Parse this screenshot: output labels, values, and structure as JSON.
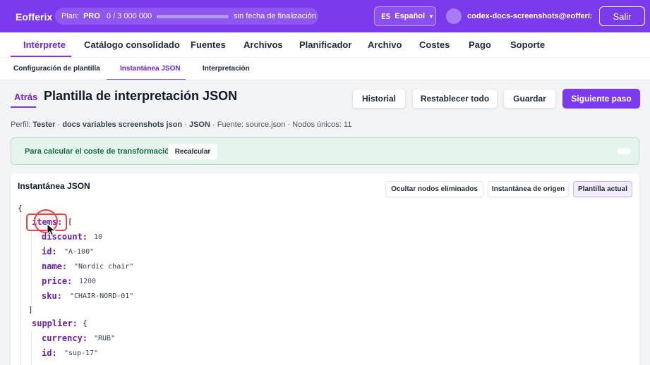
{
  "topbar": {
    "brand": "Eofferix",
    "plan_label": "Plan:",
    "plan_name": "PRO",
    "plan_usage": "0 / 3 000 000",
    "plan_progress": 0.01,
    "plan_expiry": "sin fecha de finalización",
    "lang_code": "ES",
    "lang_name": "Español",
    "user_email": "codex-docs-screenshots@eofferix",
    "logout_label": "Salir"
  },
  "main_nav": [
    "Intérprete",
    "Catálogo consolidado",
    "Fuentes",
    "Archivos",
    "Planificador",
    "Archivo",
    "Costes",
    "Pago",
    "Soporte"
  ],
  "sub_nav": [
    "Configuración de plantilla",
    "Instantánea JSON",
    "Interpretación"
  ],
  "header": {
    "back_label": "Atrás",
    "title": "Plantilla de interpretación JSON",
    "buttons": {
      "history": "Historial",
      "reset": "Restablecer todo",
      "save": "Guardar",
      "next": "Siguiente paso"
    }
  },
  "meta": {
    "profile_label": "Perfil:",
    "profile": "Tester",
    "sep": "·",
    "docs": "docs variables screenshots json",
    "format": "JSON",
    "source": "Fuente: source.json",
    "nodes": "Nodos únicos: 11"
  },
  "notice": {
    "text": "Para calcular el coste de transformación",
    "recalc": "Recalcular"
  },
  "snapshot": {
    "title": "Instantánea JSON",
    "btn_hide": "Ocultar nodos eliminados",
    "btn_source": "Instantánea de origen",
    "btn_current": "Plantilla actual"
  },
  "json": {
    "open_brace": "{",
    "items_key": "items",
    "items_open": "[",
    "items_close": "]",
    "colon": ":",
    "items": [
      {
        "key": "discount",
        "value": "10",
        "kind": "num"
      },
      {
        "key": "id",
        "value": "\"A-100\"",
        "kind": "str"
      },
      {
        "key": "name",
        "value": "\"Nordic chair\"",
        "kind": "str"
      },
      {
        "key": "price",
        "value": "1200",
        "kind": "num"
      },
      {
        "key": "sku",
        "value": "\"CHAIR-NORD-01\"",
        "kind": "str"
      }
    ],
    "supplier_key": "supplier",
    "supplier_open": "{",
    "supplier": [
      {
        "key": "currency",
        "value": "\"RUB\"",
        "kind": "str"
      },
      {
        "key": "id",
        "value": "\"sup-17\"",
        "kind": "str"
      }
    ]
  },
  "colors": {
    "accent": "#7c3aed",
    "highlight": "#ef4444",
    "notice_bg": "#e6f4ee"
  }
}
